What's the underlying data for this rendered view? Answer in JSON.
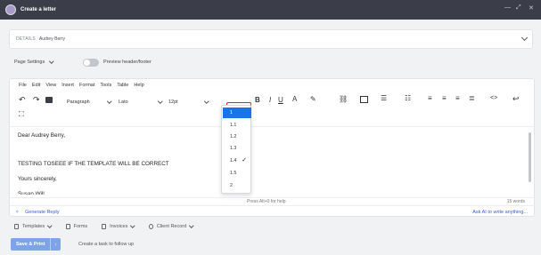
{
  "window": {
    "title": "Create a letter",
    "controls": [
      "—",
      "⤢",
      "✕"
    ]
  },
  "details": {
    "label": "DETAILS",
    "value": "Audrey Berry"
  },
  "page_settings": {
    "label": "Page Settings",
    "toggle_on": false,
    "preview_label": "Preview header/footer"
  },
  "menu": [
    "File",
    "Edit",
    "View",
    "Insert",
    "Format",
    "Tools",
    "Table",
    "Help"
  ],
  "toolbar": {
    "block_format": "Paragraph",
    "font_family": "Lato",
    "font_size": "12pt"
  },
  "line_height": {
    "options": [
      "1",
      "1.1",
      "1.2",
      "1.3",
      "1.4",
      "1.5",
      "2"
    ],
    "highlighted": "1",
    "checked": "1.4"
  },
  "document": {
    "lines": [
      "Dear Audrey Berry,",
      "TESTING TOSEEE IF THE TEMPLATE WILL BE CORRECT",
      "Yours sincerely,",
      "Susan Will..."
    ]
  },
  "status": {
    "help": "Press Alt+0 for help",
    "words": "15 words"
  },
  "generate_reply": "Generate Reply",
  "ask_ai": "Ask AI to write anything...",
  "bottom_tabs": [
    "Templates",
    "Forms",
    "Invoices",
    "Client Record"
  ],
  "actions": {
    "save_print": "Save & Print",
    "create_task": "Create a task to follow up"
  },
  "colors": {
    "accent": "#1a73e8",
    "highlight_box": "#e1262c",
    "titlebar": "#3b3e48",
    "link": "#3b5bdb"
  }
}
